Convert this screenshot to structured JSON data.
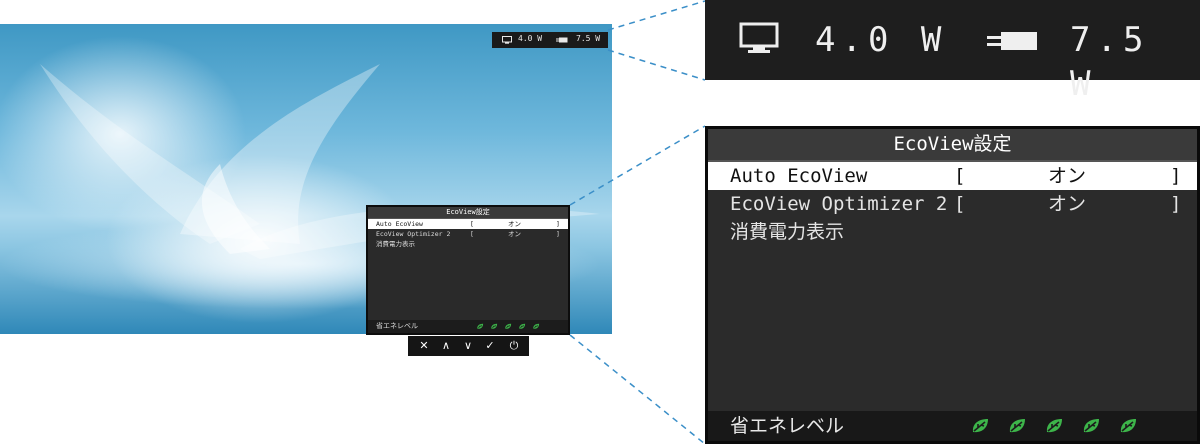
{
  "power": {
    "monitor_value": "4.0",
    "monitor_unit": "W",
    "system_value": "7.5",
    "system_unit": "W"
  },
  "menu": {
    "title": "EcoView設定",
    "items": [
      {
        "label": "Auto EcoView",
        "bracket_open": "[",
        "value": "オン",
        "bracket_close": "]"
      },
      {
        "label": "EcoView Optimizer 2",
        "bracket_open": "[",
        "value": "オン",
        "bracket_close": "]"
      },
      {
        "label": "消費電力表示"
      }
    ],
    "footer_label": "省エネレベル",
    "eco_level": 5,
    "eco_level_max": 5
  },
  "buttons": [
    {
      "name": "close",
      "glyph": "✕"
    },
    {
      "name": "up",
      "glyph": "∧"
    },
    {
      "name": "down",
      "glyph": "∨"
    },
    {
      "name": "enter",
      "glyph": "✓"
    },
    {
      "name": "power",
      "glyph": "⏻"
    }
  ],
  "colors": {
    "leaf_green": "#3db54a",
    "menu_bg": "#2b2b2b",
    "selected_bg": "#ffffff"
  },
  "icons": {
    "monitor": "monitor-icon",
    "plug": "plug-icon",
    "leaf": "leaf-icon"
  }
}
